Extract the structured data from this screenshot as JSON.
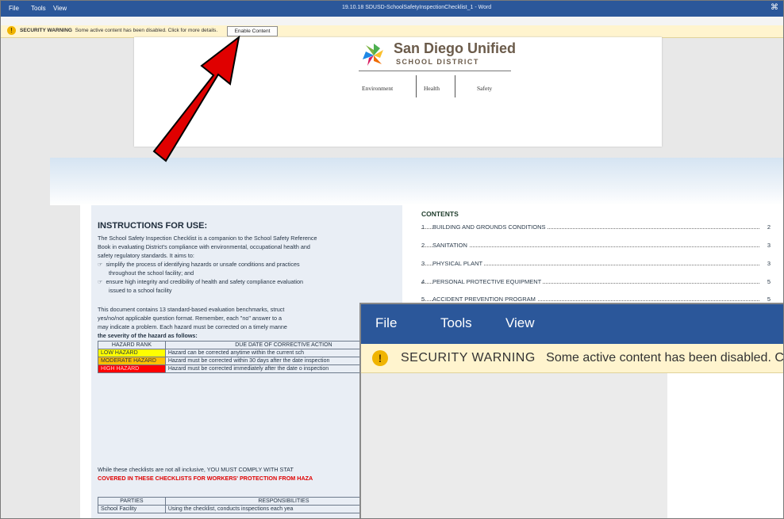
{
  "menubar": {
    "items": [
      "File",
      "Tools",
      "View"
    ],
    "title": "19.10.18 SDUSD-SchoolSafetyInspectionChecklist_1 - Word"
  },
  "security_bar": {
    "label": "SECURITY WARNING",
    "message": "Some active content has been disabled. Click for more details.",
    "button": "Enable Content"
  },
  "header": {
    "brand_line1": "San Diego Unified",
    "brand_line2": "SCHOOL DISTRICT",
    "tabs": [
      "Environment",
      "Health",
      "Safety"
    ]
  },
  "instructions": {
    "title": "INSTRUCTIONS FOR USE:",
    "lines": [
      "The School Safety Inspection Checklist is a companion to the School Safety Reference",
      "Book in evaluating District's compliance with environmental, occupational health and",
      "safety regulatory standards. It aims to:"
    ],
    "bullets": [
      "simplify the process of identifying hazards or unsafe conditions and practices",
      "throughout the school facility; and",
      "ensure high integrity and credibility of health and safety compliance evaluation",
      "issued to a school facility"
    ],
    "para2": [
      "This document contains 13 standard-based evaluation benchmarks, struct",
      "yes/no/not applicable question format. Remember, each \"no\" answer to a",
      "may indicate a problem. Each hazard must be corrected on a timely manne",
      "the severity of the hazard as follows:"
    ],
    "hazard_table": {
      "headers": [
        "HAZARD RANK",
        "DUE DATE OF CORRECTIVE ACTION"
      ],
      "rows": [
        {
          "rank": "LOW HAZARD",
          "action": "Hazard can be corrected anytime within the current sch",
          "color": "#ffff00"
        },
        {
          "rank": "MODERATE HAZARD",
          "action": "Hazard must be corrected within 30 days after the date inspection",
          "color": "#ffc000"
        },
        {
          "rank": "HIGH HAZARD",
          "action": "Hazard must be corrected immediately after the date o inspection",
          "color": "#ff0000"
        }
      ]
    },
    "comply_line1": "While these checklists are not all inclusive, YOU MUST COMPLY WITH STAT",
    "comply_line2": "COVERED IN THESE CHECKLISTS FOR WORKERS' PROTECTION FROM HAZA",
    "parties_table": {
      "headers": [
        "PARTIES",
        "RESPONSIBILITIES"
      ],
      "row": [
        "School Facility",
        "Using the checklist, conducts inspections each yea"
      ]
    }
  },
  "contents": {
    "title": "CONTENTS",
    "items": [
      {
        "num": "1",
        "label": "BUILDING AND GROUNDS CONDITIONS",
        "page": "2"
      },
      {
        "num": "2",
        "label": "SANITATION",
        "page": "3"
      },
      {
        "num": "3",
        "label": "PHYSICAL PLANT",
        "page": "3"
      },
      {
        "num": "4",
        "label": "PERSONAL PROTECTIVE EQUIPMENT",
        "page": "5"
      },
      {
        "num": "5",
        "label": "ACCIDENT PREVENTION PROGRAM",
        "page": "5"
      }
    ]
  },
  "zoom": {
    "menu": [
      "File",
      "Tools",
      "View"
    ],
    "warning_label": "SECURITY WARNING",
    "warning_text": "Some active content has been disabled. Click fo"
  },
  "colors": {
    "ribbon": "#2b579a",
    "warning_bg": "#fff4ce",
    "arrow": "#e00000"
  }
}
